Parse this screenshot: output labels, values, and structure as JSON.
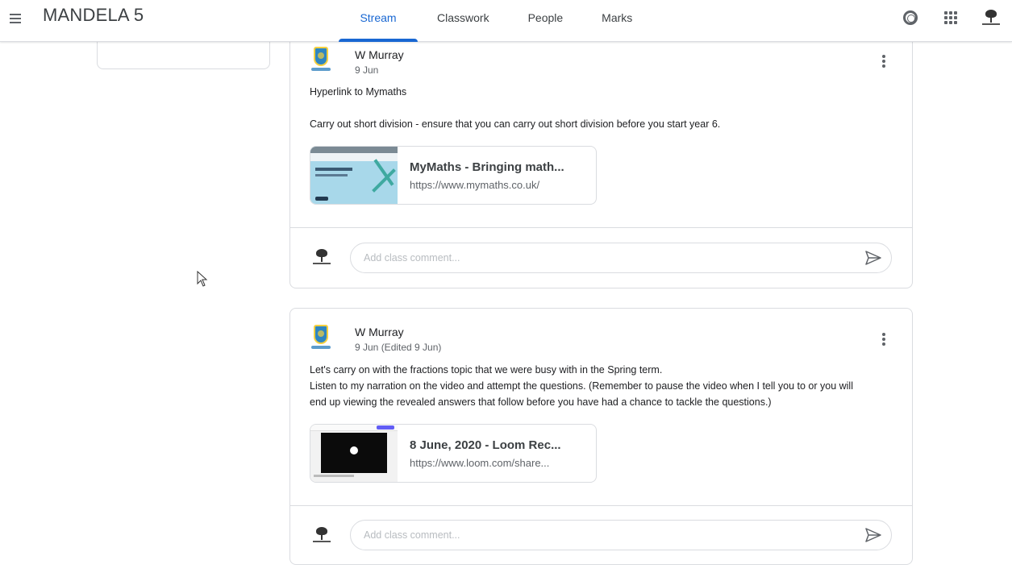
{
  "topbar": {
    "class_title": "MANDELA 5",
    "tabs": [
      "Stream",
      "Classwork",
      "People",
      "Marks"
    ],
    "active_tab": "Stream"
  },
  "posts": [
    {
      "author": "W Murray",
      "date": "9 Jun",
      "text_lines": [
        "Hyperlink to Mymaths",
        "",
        "Carry out short division - ensure that you can carry out short division before you start year 6."
      ],
      "attachment": {
        "title": "MyMaths - Bringing math...",
        "url": "https://www.mymaths.co.uk/"
      },
      "comment_placeholder": "Add class comment..."
    },
    {
      "author": "W Murray",
      "date": "9 Jun (Edited 9 Jun)",
      "text_lines": [
        "Let's carry on with the fractions topic that we were busy with in the Spring term.",
        "Listen to my narration on the video and attempt the questions. (Remember to pause the video when I tell you to or you will",
        "end up viewing the revealed answers that follow before you have had a chance to tackle the questions.)"
      ],
      "attachment": {
        "title": "8 June, 2020 - Loom Rec...",
        "url": "https://www.loom.com/share..."
      },
      "comment_placeholder": "Add class comment..."
    }
  ],
  "icons": {
    "menu": "hamburger-menu-icon",
    "settings": "gear-icon",
    "apps": "apps-grid-icon",
    "account": "tree-logo-avatar",
    "more": "more-vert-icon",
    "send": "send-icon"
  },
  "colors": {
    "accent": "#1967d2",
    "border": "#dadce0",
    "text": "#202124",
    "muted": "#5f6368"
  }
}
